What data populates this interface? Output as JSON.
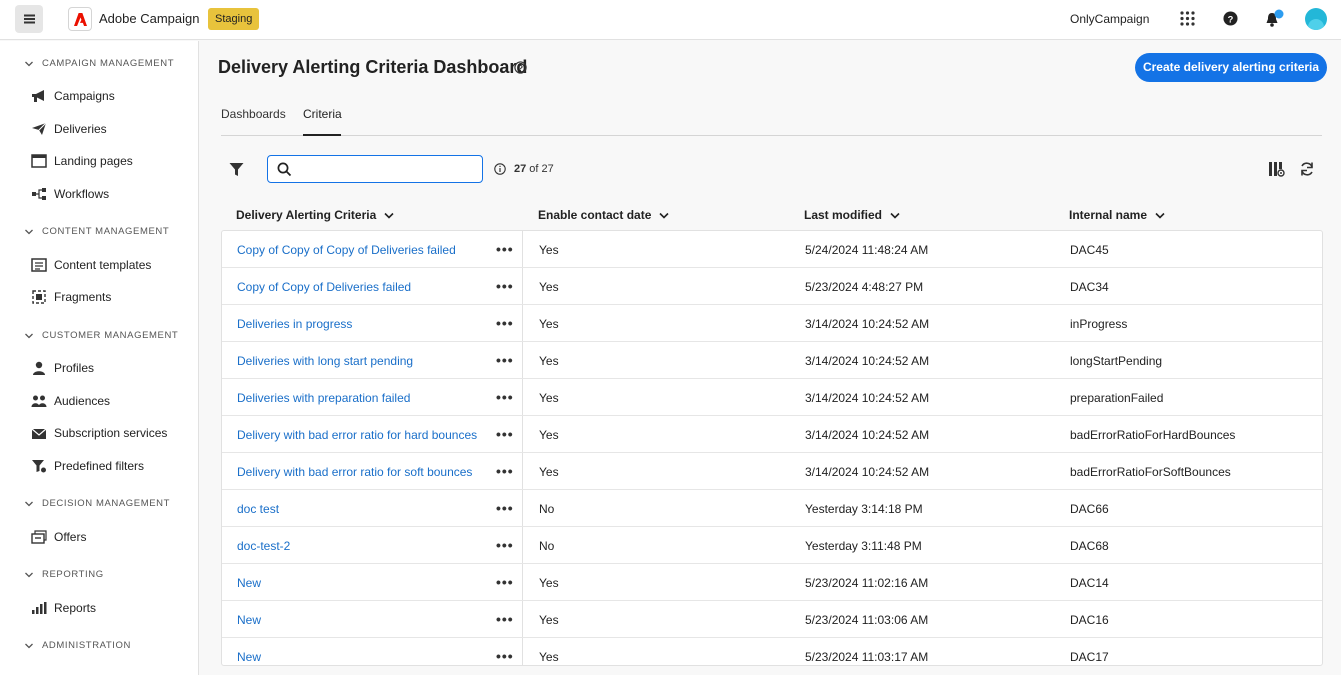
{
  "header": {
    "app_name": "Adobe Campaign",
    "env_badge": "Staging",
    "org_name": "OnlyCampaign"
  },
  "sidebar": {
    "sections": [
      {
        "title": "CAMPAIGN MANAGEMENT",
        "items": [
          {
            "label": "Campaigns",
            "icon": "megaphone-icon"
          },
          {
            "label": "Deliveries",
            "icon": "paper-plane-icon"
          },
          {
            "label": "Landing pages",
            "icon": "browser-icon"
          },
          {
            "label": "Workflows",
            "icon": "workflow-icon"
          }
        ]
      },
      {
        "title": "CONTENT MANAGEMENT",
        "items": [
          {
            "label": "Content templates",
            "icon": "template-icon"
          },
          {
            "label": "Fragments",
            "icon": "fragment-icon"
          }
        ]
      },
      {
        "title": "CUSTOMER MANAGEMENT",
        "items": [
          {
            "label": "Profiles",
            "icon": "user-icon"
          },
          {
            "label": "Audiences",
            "icon": "group-icon"
          },
          {
            "label": "Subscription services",
            "icon": "envelope-icon"
          },
          {
            "label": "Predefined filters",
            "icon": "filter-icon"
          }
        ]
      },
      {
        "title": "DECISION MANAGEMENT",
        "items": [
          {
            "label": "Offers",
            "icon": "offer-icon"
          }
        ]
      },
      {
        "title": "REPORTING",
        "items": [
          {
            "label": "Reports",
            "icon": "bar-chart-icon"
          }
        ]
      },
      {
        "title": "ADMINISTRATION",
        "items": []
      }
    ]
  },
  "page": {
    "title": "Delivery Alerting Criteria Dashboard",
    "create_button": "Create delivery alerting criteria",
    "tabs": [
      {
        "label": "Dashboards",
        "active": false
      },
      {
        "label": "Criteria",
        "active": true
      }
    ],
    "search": {
      "value": "",
      "placeholder": ""
    },
    "count": {
      "shown": "27",
      "of_text": "of 27"
    }
  },
  "table": {
    "columns": [
      "Delivery Alerting Criteria",
      "Enable contact date",
      "Last modified",
      "Internal name"
    ],
    "more_glyph": "•••",
    "rows": [
      {
        "name": "Copy of Copy of Copy of Deliveries failed",
        "enable": "Yes",
        "modified": "5/24/2024 11:48:24 AM",
        "internal": "DAC45"
      },
      {
        "name": "Copy of Copy of Deliveries failed",
        "enable": "Yes",
        "modified": "5/23/2024 4:48:27 PM",
        "internal": "DAC34"
      },
      {
        "name": "Deliveries in progress",
        "enable": "Yes",
        "modified": "3/14/2024 10:24:52 AM",
        "internal": "inProgress"
      },
      {
        "name": "Deliveries with long start pending",
        "enable": "Yes",
        "modified": "3/14/2024 10:24:52 AM",
        "internal": "longStartPending"
      },
      {
        "name": "Deliveries with preparation failed",
        "enable": "Yes",
        "modified": "3/14/2024 10:24:52 AM",
        "internal": "preparationFailed"
      },
      {
        "name": "Delivery with bad error ratio for hard bounces",
        "enable": "Yes",
        "modified": "3/14/2024 10:24:52 AM",
        "internal": "badErrorRatioForHardBounces"
      },
      {
        "name": "Delivery with bad error ratio for soft bounces",
        "enable": "Yes",
        "modified": "3/14/2024 10:24:52 AM",
        "internal": "badErrorRatioForSoftBounces"
      },
      {
        "name": "doc test",
        "enable": "No",
        "modified": "Yesterday 3:14:18 PM",
        "internal": "DAC66"
      },
      {
        "name": "doc-test-2",
        "enable": "No",
        "modified": "Yesterday 3:11:48 PM",
        "internal": "DAC68"
      },
      {
        "name": "New",
        "enable": "Yes",
        "modified": "5/23/2024 11:02:16 AM",
        "internal": "DAC14"
      },
      {
        "name": "New",
        "enable": "Yes",
        "modified": "5/23/2024 11:03:06 AM",
        "internal": "DAC16"
      },
      {
        "name": "New",
        "enable": "Yes",
        "modified": "5/23/2024 11:03:17 AM",
        "internal": "DAC17"
      }
    ]
  },
  "colors": {
    "accent": "#1473e6",
    "link": "#1a6fc9",
    "badge": "#e8c33c"
  }
}
